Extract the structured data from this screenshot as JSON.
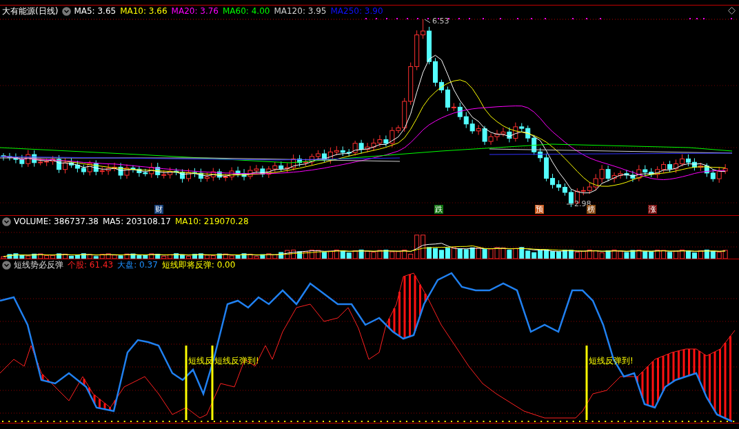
{
  "main_panel": {
    "title": "大有能源(日线)",
    "indicators": [
      {
        "label": "MA5: 3.65",
        "color": "#ffffff"
      },
      {
        "label": "MA10: 3.66",
        "color": "#ffff00"
      },
      {
        "label": "MA20: 3.76",
        "color": "#ff00ff"
      },
      {
        "label": "MA60: 4.00",
        "color": "#00ff00"
      },
      {
        "label": "MA120: 3.95",
        "color": "#d0d0d0"
      },
      {
        "label": "MA250: 3.90",
        "color": "#1010ff"
      }
    ],
    "high_label": "6.53",
    "low_label": "2.98",
    "markers": [
      {
        "text": "财",
        "color": "#17407a"
      },
      {
        "text": "跌",
        "color": "#127512"
      },
      {
        "text": "预",
        "color": "#c8561a"
      },
      {
        "text": "榜",
        "color": "#8a4a12"
      },
      {
        "text": "涨",
        "color": "#7a1010"
      }
    ]
  },
  "volume_panel": {
    "indicators": [
      {
        "label": "VOLUME: 386737.38",
        "color": "#ffffff"
      },
      {
        "label": "MA5: 203108.17",
        "color": "#ffffff"
      },
      {
        "label": "MA10: 219070.28",
        "color": "#ffff00"
      }
    ]
  },
  "signal_panel": {
    "title": "短线势必反弹",
    "indicators": [
      {
        "label": "个股: 61.43",
        "color": "#ff2020"
      },
      {
        "label": "大盘: 0.37",
        "color": "#1e90ff"
      },
      {
        "label": "短线即将反弹: 0.00",
        "color": "#ffff00"
      }
    ],
    "signals": [
      {
        "text": "短线反"
      },
      {
        "text": "短线反弹到!"
      },
      {
        "text": "短线反弹到!"
      }
    ]
  }
}
